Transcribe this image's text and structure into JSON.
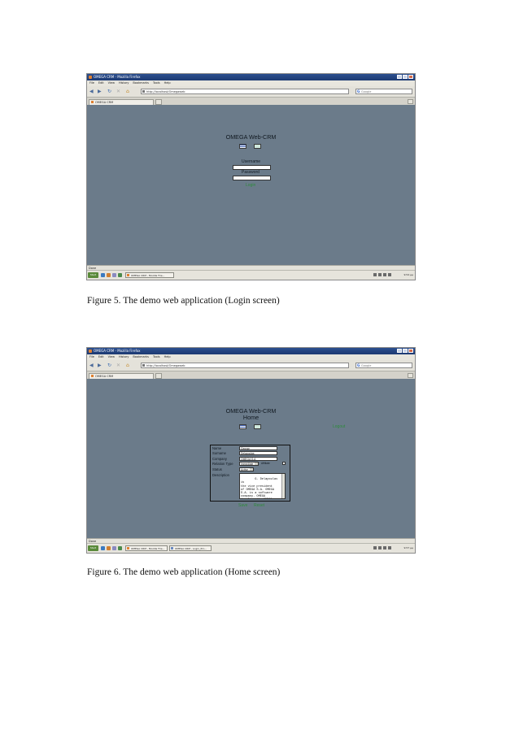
{
  "browser": {
    "window_title": "OMEGA CRM - Mozilla Firefox",
    "menu": [
      "File",
      "Edit",
      "View",
      "History",
      "Bookmarks",
      "Tools",
      "Help"
    ],
    "address": "http://localhost/Omegaweb",
    "search_placeholder": "Google",
    "search_logo": "G",
    "tab_label": "OMEGA CRM",
    "status": "Done",
    "start_label": "Start",
    "taskbar_item_1": "OMEGA CRM - Mozilla Fire...",
    "taskbar_item_2": "OMEGA CRM - Login_Pro...",
    "clock_1": "9:54 μμ",
    "clock_2": "9:57 μμ"
  },
  "login_screen": {
    "app_title": "OMEGA Web-CRM",
    "username_label": "Username",
    "password_label": "Password",
    "login_link": "Login",
    "caption": "Figure 5. The demo web application (Login screen)"
  },
  "home_screen": {
    "app_title": "OMEGA Web-CRM",
    "subtitle": "Home",
    "logout_link": "Logout",
    "form": {
      "name_label": "Name",
      "name_value": "George",
      "surname_label": "Surname",
      "surname_value": "Delapoulas",
      "company_label": "Company",
      "company_value": "OMEGA S.A",
      "relation_label": "Relation Type",
      "relation_value": "Immediate",
      "relation_option_2": "Affiliate",
      "status_label": "Status",
      "status_value": "Active",
      "description_label": "Description",
      "description_value": "G. Delapoulas is\nthe vice president\nof OMEGA S.A. OMEGA\nS.A. is a software\ncompany. OMEGA\ndevelops the OMEGA"
    },
    "save_link": "Save",
    "reset_link": "Reset",
    "caption": "Figure 6. The demo web application (Home screen)"
  }
}
